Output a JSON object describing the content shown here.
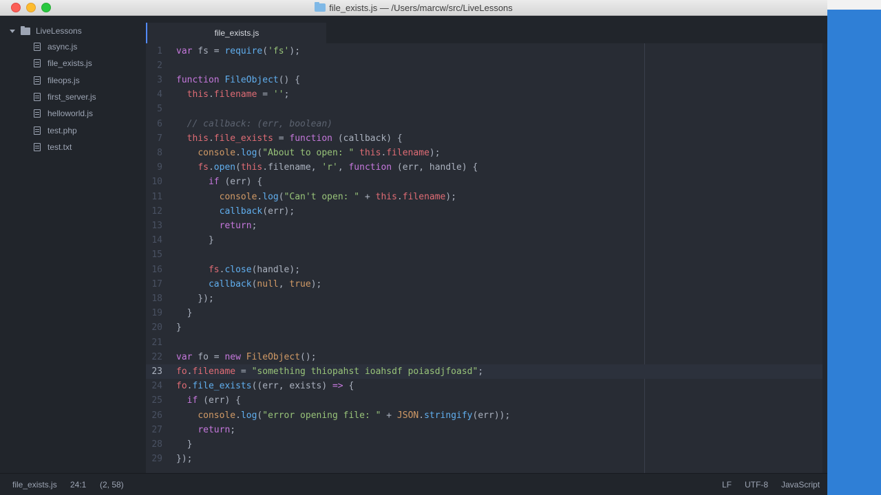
{
  "window": {
    "title": "file_exists.js — /Users/marcw/src/LiveLessons"
  },
  "sidebar": {
    "root": "LiveLessons",
    "files": [
      "async.js",
      "file_exists.js",
      "fileops.js",
      "first_server.js",
      "helloworld.js",
      "test.php",
      "test.txt"
    ]
  },
  "tabs": [
    {
      "label": "file_exists.js",
      "active": true
    }
  ],
  "editor": {
    "language": "JavaScript",
    "active_line": 23,
    "lines": [
      [
        [
          "var",
          "k"
        ],
        [
          " fs = ",
          ""
        ],
        [
          "require",
          "f"
        ],
        [
          "(",
          ""
        ],
        [
          "'fs'",
          "s"
        ],
        [
          ");",
          ""
        ]
      ],
      [],
      [
        [
          "function",
          "k"
        ],
        [
          " ",
          ""
        ],
        [
          "FileObject",
          "f"
        ],
        [
          "() {",
          ""
        ]
      ],
      [
        [
          "  ",
          ""
        ],
        [
          "this",
          "v"
        ],
        [
          ".",
          ""
        ],
        [
          "filename",
          "v"
        ],
        [
          " = ",
          ""
        ],
        [
          "''",
          "s"
        ],
        [
          ";",
          ""
        ]
      ],
      [],
      [
        [
          "  ",
          ""
        ],
        [
          "// callback: (err, boolean)",
          "c"
        ]
      ],
      [
        [
          "  ",
          ""
        ],
        [
          "this",
          "v"
        ],
        [
          ".",
          ""
        ],
        [
          "file_exists",
          "v"
        ],
        [
          " = ",
          ""
        ],
        [
          "function",
          "k"
        ],
        [
          " (callback) {",
          ""
        ]
      ],
      [
        [
          "    ",
          ""
        ],
        [
          "console",
          "n"
        ],
        [
          ".",
          ""
        ],
        [
          "log",
          "f"
        ],
        [
          "(",
          ""
        ],
        [
          "\"About to open: \"",
          "s"
        ],
        [
          " ",
          ""
        ],
        [
          "this",
          "v"
        ],
        [
          ".",
          ""
        ],
        [
          "filename",
          "v"
        ],
        [
          ");",
          ""
        ]
      ],
      [
        [
          "    ",
          ""
        ],
        [
          "fs",
          "v"
        ],
        [
          ".",
          ""
        ],
        [
          "open",
          "f"
        ],
        [
          "(",
          ""
        ],
        [
          "this",
          "v"
        ],
        [
          ".filename, ",
          ""
        ],
        [
          "'r'",
          "s"
        ],
        [
          ", ",
          ""
        ],
        [
          "function",
          "k"
        ],
        [
          " (err, handle) {",
          ""
        ]
      ],
      [
        [
          "      ",
          ""
        ],
        [
          "if",
          "k"
        ],
        [
          " (err) {",
          ""
        ]
      ],
      [
        [
          "        ",
          ""
        ],
        [
          "console",
          "n"
        ],
        [
          ".",
          ""
        ],
        [
          "log",
          "f"
        ],
        [
          "(",
          ""
        ],
        [
          "\"Can't open: \"",
          "s"
        ],
        [
          " + ",
          ""
        ],
        [
          "this",
          "v"
        ],
        [
          ".",
          ""
        ],
        [
          "filename",
          "v"
        ],
        [
          ");",
          ""
        ]
      ],
      [
        [
          "        ",
          ""
        ],
        [
          "callback",
          "f"
        ],
        [
          "(err);",
          ""
        ]
      ],
      [
        [
          "        ",
          ""
        ],
        [
          "return",
          "k"
        ],
        [
          ";",
          ""
        ]
      ],
      [
        [
          "      }",
          ""
        ]
      ],
      [],
      [
        [
          "      ",
          ""
        ],
        [
          "fs",
          "v"
        ],
        [
          ".",
          ""
        ],
        [
          "close",
          "f"
        ],
        [
          "(handle);",
          ""
        ]
      ],
      [
        [
          "      ",
          ""
        ],
        [
          "callback",
          "f"
        ],
        [
          "(",
          ""
        ],
        [
          "null",
          "n"
        ],
        [
          ", ",
          ""
        ],
        [
          "true",
          "n"
        ],
        [
          ");",
          ""
        ]
      ],
      [
        [
          "    });",
          ""
        ]
      ],
      [
        [
          "  }",
          ""
        ]
      ],
      [
        [
          "}",
          ""
        ]
      ],
      [],
      [
        [
          "var",
          "k"
        ],
        [
          " fo = ",
          ""
        ],
        [
          "new",
          "k"
        ],
        [
          " ",
          ""
        ],
        [
          "FileObject",
          "n"
        ],
        [
          "();",
          ""
        ]
      ],
      [
        [
          "fo",
          "v"
        ],
        [
          ".",
          ""
        ],
        [
          "filename",
          "v"
        ],
        [
          " = ",
          ""
        ],
        [
          "\"something thiopahst ioahsdf poiasdjfoasd\"",
          "s"
        ],
        [
          ";",
          ""
        ]
      ],
      [
        [
          "fo",
          "v"
        ],
        [
          ".",
          ""
        ],
        [
          "file_exists",
          "f"
        ],
        [
          "((err, exists) ",
          ""
        ],
        [
          "=>",
          "k"
        ],
        [
          " {",
          ""
        ]
      ],
      [
        [
          "  ",
          ""
        ],
        [
          "if",
          "k"
        ],
        [
          " (err) {",
          ""
        ]
      ],
      [
        [
          "    ",
          ""
        ],
        [
          "console",
          "n"
        ],
        [
          ".",
          ""
        ],
        [
          "log",
          "f"
        ],
        [
          "(",
          ""
        ],
        [
          "\"error opening file: \"",
          "s"
        ],
        [
          " + ",
          ""
        ],
        [
          "JSON",
          "n"
        ],
        [
          ".",
          ""
        ],
        [
          "stringify",
          "f"
        ],
        [
          "(err));",
          ""
        ]
      ],
      [
        [
          "    ",
          ""
        ],
        [
          "return",
          "k"
        ],
        [
          ";",
          ""
        ]
      ],
      [
        [
          "  }",
          ""
        ]
      ],
      [
        [
          "});",
          ""
        ]
      ]
    ]
  },
  "status": {
    "file": "file_exists.js",
    "cursor": "24:1",
    "selection": "(2, 58)",
    "line_ending": "LF",
    "encoding": "UTF-8",
    "grammar": "JavaScript"
  },
  "colors": {
    "accent": "#528bff",
    "keyword": "#c678dd",
    "function": "#61afef",
    "string": "#98c379",
    "variable": "#e06c75",
    "number": "#d19a66",
    "comment": "#5c6370"
  }
}
